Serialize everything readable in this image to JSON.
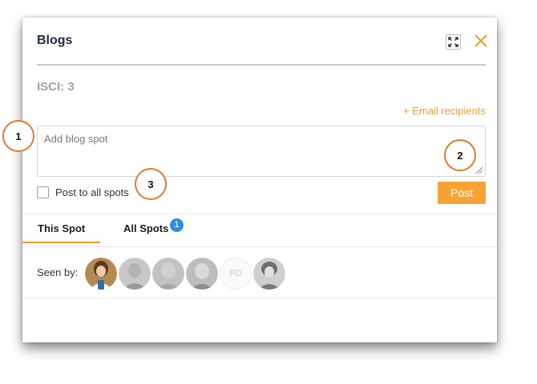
{
  "dialog": {
    "title": "Blogs",
    "isci": "ISCI: 3",
    "email_link": "+ Email recipients",
    "textarea_placeholder": "Add blog spot",
    "checkbox_label": "Post to all spots",
    "post_button": "Post"
  },
  "tabs": [
    {
      "label": "This Spot",
      "active": true
    },
    {
      "label": "All Spots",
      "badge": "1"
    }
  ],
  "seen_by": {
    "label": "Seen by:",
    "avatars": [
      {
        "type": "photo",
        "tone": "color",
        "icon": "user-photo-icon"
      },
      {
        "type": "photo",
        "tone": "faded",
        "icon": "user-photo-icon"
      },
      {
        "type": "photo",
        "tone": "faded",
        "icon": "user-photo-icon"
      },
      {
        "type": "photo",
        "tone": "faded",
        "icon": "user-photo-icon"
      },
      {
        "type": "initials",
        "initials": "PD"
      },
      {
        "type": "photo",
        "tone": "faded",
        "icon": "user-photo-icon"
      }
    ]
  },
  "markers": [
    "1",
    "2",
    "3"
  ],
  "colors": {
    "accent": "#f39b28",
    "badge": "#2f8fde",
    "title": "#1f2a44",
    "marker": "#e07a2e"
  }
}
